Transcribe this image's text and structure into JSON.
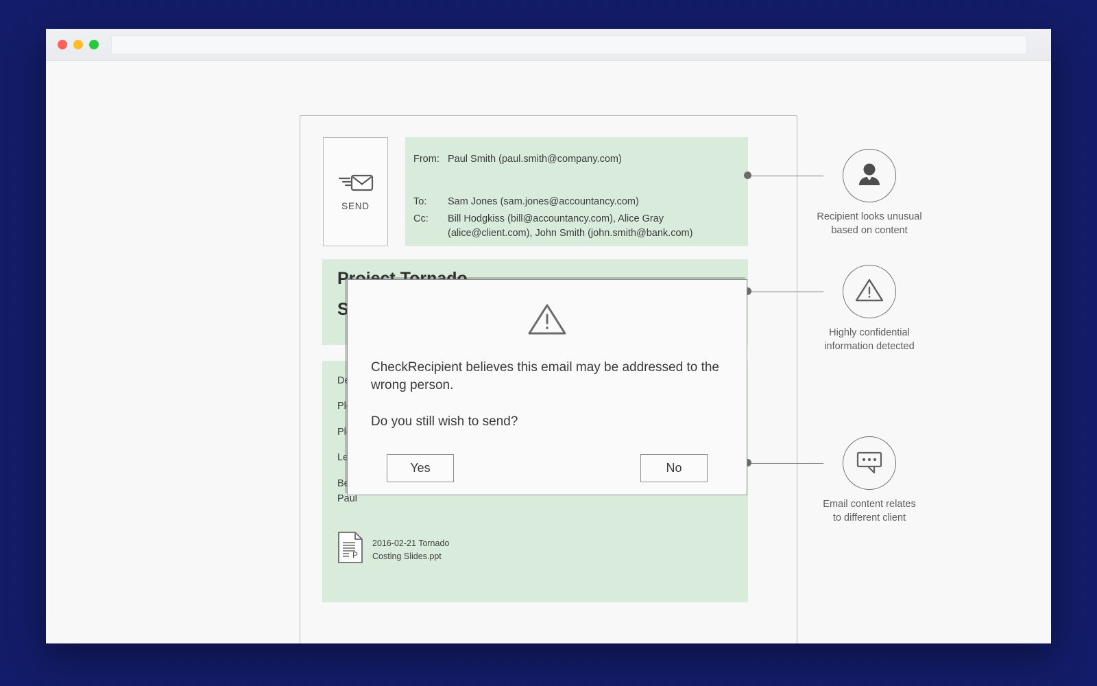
{
  "window": {
    "traffic_lights": [
      "close",
      "minimize",
      "maximize"
    ],
    "address_bar_value": "",
    "address_bar_placeholder": ""
  },
  "send_button": {
    "label": "SEND",
    "icon": "envelope-send-icon"
  },
  "email": {
    "header": {
      "from_label": "From:",
      "from_value": "Paul Smith (paul.smith@company.com)",
      "to_label": "To:",
      "to_value": "Sam Jones (sam.jones@accountancy.com)",
      "cc_label": "Cc:",
      "cc_value": "Bill Hodgkiss (bill@accountancy.com), Alice Gray (alice@client.com), John Smith (john.smith@bank.com)"
    },
    "subject": {
      "line1": "Project Tornado",
      "line2": "Subject"
    },
    "body": {
      "greeting": "Dear Sam,",
      "paragraph1": "Please find attached the costing slides for Project Tornado.",
      "paragraph2": "Please treat the information contained within as strictly confidential.",
      "paragraph3": "Let me know if anything is unclear with the costing slides.",
      "signoff": "Best wishes,",
      "signature": "Paul"
    },
    "attachment": {
      "name": "2016-02-21 Tornado\nCosting Slides.ppt",
      "icon": "powerpoint-file-icon"
    }
  },
  "annotations": [
    {
      "id": "recipient",
      "icon": "person-icon",
      "text": "Recipient looks unusual\nbased on content"
    },
    {
      "id": "confidential",
      "icon": "warning-triangle-icon",
      "text": "Highly confidential\ninformation detected"
    },
    {
      "id": "content",
      "icon": "speech-bubble-icon",
      "text": "Email content relates\nto different client"
    }
  ],
  "dialog": {
    "icon": "warning-triangle-icon",
    "message": "CheckRecipient believes this email may be addressed to the wrong person.",
    "question": "Do you still wish to send?",
    "yes_label": "Yes",
    "no_label": "No"
  },
  "colors": {
    "email_panel": "#d9ecdb",
    "page_background": "#f8f8f8",
    "desktop_blue": "#2639c6",
    "outline_gray": "#b9b9b9",
    "icon_gray": "#6e6e6e",
    "traffic_red": "#ff6059",
    "traffic_yellow": "#ffbd2e",
    "traffic_green": "#28c840"
  }
}
